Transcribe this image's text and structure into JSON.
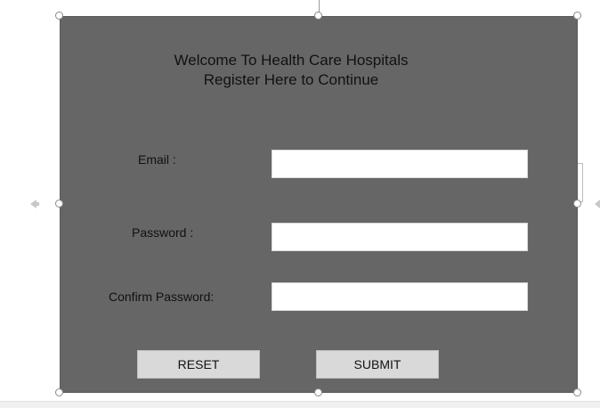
{
  "form": {
    "title_line1": "Welcome To Health Care Hospitals",
    "title_line2": "Register Here to Continue",
    "email_label": "Email :",
    "password_label": "Password :",
    "confirm_label": "Confirm Password:",
    "email_value": "",
    "password_value": "",
    "confirm_value": "",
    "reset_label": "RESET",
    "submit_label": "SUBMIT"
  },
  "colors": {
    "panel": "#666666",
    "field": "#ffffff",
    "button": "#d9d9d9",
    "text": "#111111"
  },
  "icons": {
    "left_nav": "arrow-left-icon",
    "right_nav": "arrow-right-icon",
    "selection_handle": "resize-handle-icon"
  }
}
